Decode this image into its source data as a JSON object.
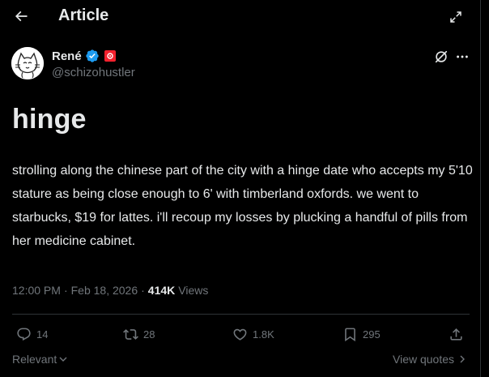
{
  "header": {
    "title": "Article",
    "back_icon": "arrow-left-icon",
    "expand_icon": "expand-icon"
  },
  "author": {
    "name": "René",
    "handle": "@schizohustler",
    "verified_color": "#1d9bf0",
    "badge_color": "#f4212e"
  },
  "article": {
    "title": "hinge",
    "body": "strolling along the chinese part of the city with a hinge date who accepts my 5'10 stature as being close enough to 6' with timberland oxfords. we went to starbucks, $19 for lattes. i'll recoup my losses by plucking a handful of pills from her medicine cabinet."
  },
  "meta": {
    "time": "12:00 PM",
    "separator": "·",
    "date": "Feb 18, 2026",
    "views_count": "414K",
    "views_label": "Views"
  },
  "actions": {
    "replies": "14",
    "reposts": "28",
    "likes": "1.8K",
    "bookmarks": "295"
  },
  "footer": {
    "sort_label": "Relevant",
    "quotes_label": "View quotes"
  },
  "colors": {
    "background": "#000000",
    "text": "#e7e9ea",
    "muted": "#71767b",
    "border": "#2f3336"
  }
}
